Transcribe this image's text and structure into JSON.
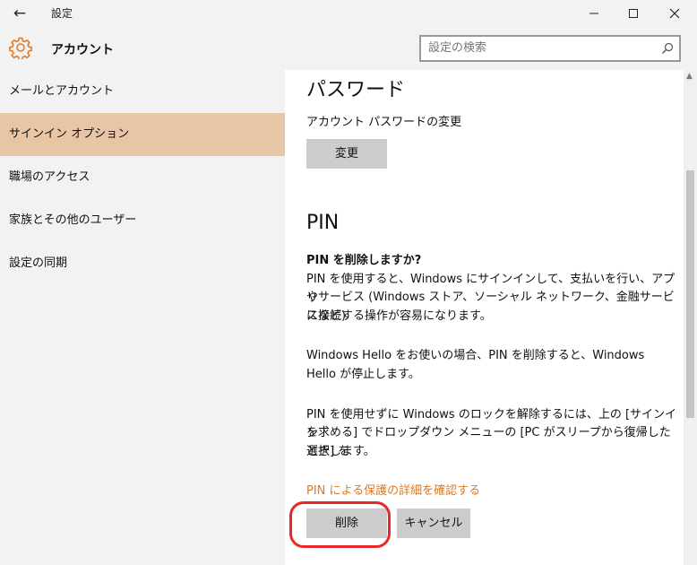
{
  "window": {
    "back_icon": "←",
    "title": "設定"
  },
  "header": {
    "icon": "gear-icon",
    "title": "アカウント",
    "accent_color": "#e07b27",
    "search_placeholder": "設定の検索"
  },
  "sidebar": {
    "items": [
      {
        "label": "メールとアカウント",
        "selected": false
      },
      {
        "label": "サインイン オプション",
        "selected": true
      },
      {
        "label": "職場のアクセス",
        "selected": false
      },
      {
        "label": "家族とその他のユーザー",
        "selected": false
      },
      {
        "label": "設定の同期",
        "selected": false
      }
    ],
    "selected_color": "#e8c5a4"
  },
  "password": {
    "title": "パスワード",
    "label": "アカウント パスワードの変更",
    "change_button": "変更"
  },
  "pin": {
    "title": "PIN",
    "question": "PIN を削除しますか?",
    "paragraph1_line1": "PIN を使用すると、Windows にサインインして、支払いを行い、アプリ",
    "paragraph1_line2": "やサービス (Windows ストア、ソーシャル ネットワーク、金融サービスなど)",
    "paragraph1_line3": "に接続する操作が容易になります。",
    "paragraph2_line1": "Windows Hello をお使いの場合、PIN を削除すると、Windows",
    "paragraph2_line2": "Hello が停止します。",
    "paragraph3_line1": "PIN を使用せずに Windows のロックを解除するには、上の [サインイン",
    "paragraph3_line2": "を求める] でドロップダウン メニューの [PC がスリープから復帰したとき] を",
    "paragraph3_line3": "選択します。",
    "link": "PIN による保護の詳細を確認する",
    "link_color": "#d67b27",
    "delete_button": "削除",
    "cancel_button": "キャンセル",
    "highlight_color": "#e8282b"
  }
}
